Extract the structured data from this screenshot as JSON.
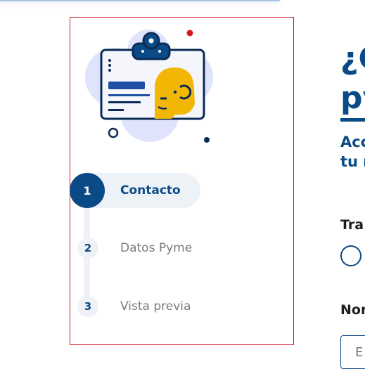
{
  "steps": [
    {
      "number": "1",
      "label": "Contacto",
      "state": "active"
    },
    {
      "number": "2",
      "label": "Datos Pyme",
      "state": "inactive"
    },
    {
      "number": "3",
      "label": "Vista previa",
      "state": "inactive"
    }
  ],
  "main": {
    "title_line1": "¿C",
    "title_line2": "py",
    "subtitle_line1": "Acc",
    "subtitle_line2": "tu r",
    "field1_label": "Tra",
    "field2_label": "Nor",
    "field2_placeholder": "E"
  },
  "colors": {
    "primary": "#0a4a86",
    "accent_red": "#d61a24",
    "avatar_yellow": "#f2b705",
    "blob": "#dfe3fb"
  },
  "icons": {
    "illustration": "id-badge-icon"
  }
}
